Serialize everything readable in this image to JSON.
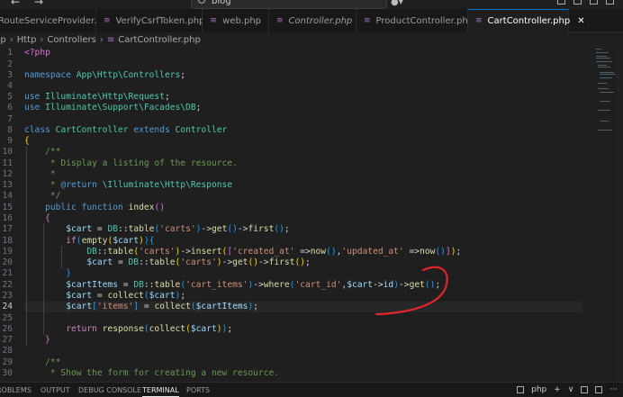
{
  "titlebar": {
    "search_text": "blog",
    "back_icon": "arrow-left-icon",
    "forward_icon": "arrow-right-icon",
    "account_icon": "copilot-icon"
  },
  "tabs": [
    {
      "label": "RouteServiceProvider.php",
      "italic": false,
      "active": false
    },
    {
      "label": "VerifyCsrfToken.php",
      "italic": false,
      "active": false
    },
    {
      "label": "web.php",
      "italic": false,
      "active": false
    },
    {
      "label": "Controller.php",
      "italic": true,
      "active": false
    },
    {
      "label": "ProductController.php",
      "italic": false,
      "active": false
    },
    {
      "label": "CartController.php",
      "italic": false,
      "active": true
    }
  ],
  "breadcrumb": [
    "pp",
    "Http",
    "Controllers",
    "CartController.php"
  ],
  "editor": {
    "line_numbers": [
      "1",
      "2",
      "3",
      "4",
      "5",
      "6",
      "7",
      "8",
      "9",
      "10",
      "11",
      "12",
      "13",
      "14",
      "15",
      "16",
      "17",
      "18",
      "19",
      "20",
      "21",
      "22",
      "23",
      "24",
      "25",
      "26",
      "27",
      "28",
      "29",
      "30"
    ],
    "current_line": "24"
  },
  "panel": {
    "tabs": [
      "ROBLEMS",
      "OUTPUT",
      "DEBUG CONSOLE",
      "TERMINAL",
      "PORTS"
    ],
    "active_tab": "TERMINAL",
    "terminal_name": "php",
    "plus": "+",
    "chevron": "∨"
  },
  "annotation_color": "#e0262a"
}
